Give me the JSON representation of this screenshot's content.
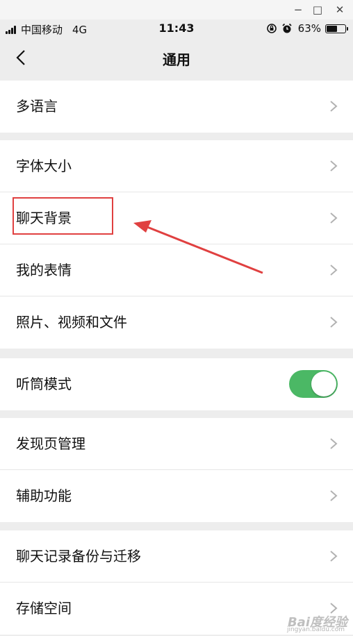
{
  "window": {
    "minimize": "−",
    "maximize": "□",
    "close": "✕"
  },
  "status": {
    "carrier": "中国移动",
    "network": "4G",
    "time": "11:43",
    "battery": "63%",
    "battery_level": 0.63
  },
  "nav": {
    "title": "通用"
  },
  "groups": [
    {
      "items": [
        {
          "label": "多语言"
        }
      ]
    },
    {
      "items": [
        {
          "label": "字体大小"
        },
        {
          "label": "聊天背景"
        },
        {
          "label": "我的表情"
        },
        {
          "label": "照片、视频和文件"
        }
      ]
    },
    {
      "items": [
        {
          "label": "听筒模式",
          "toggle": true
        }
      ]
    },
    {
      "items": [
        {
          "label": "发现页管理"
        },
        {
          "label": "辅助功能"
        }
      ]
    },
    {
      "items": [
        {
          "label": "聊天记录备份与迁移"
        },
        {
          "label": "存储空间"
        }
      ]
    }
  ],
  "colors": {
    "toggle_on": "#4bb865",
    "annotation": "#e04040"
  },
  "watermark": {
    "main": "Bai度经验",
    "sub": "jingyan.baidu.com"
  }
}
